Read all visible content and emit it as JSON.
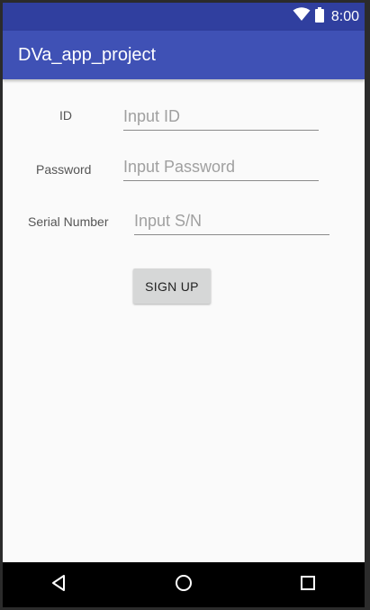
{
  "status_bar": {
    "time": "8:00",
    "icons": [
      "wifi-icon",
      "battery-icon"
    ]
  },
  "app_bar": {
    "title": "DVa_app_project"
  },
  "form": {
    "id_label": "ID",
    "id_placeholder": "Input ID",
    "password_label": "Password",
    "password_placeholder": "Input Password",
    "serial_label": "Serial Number",
    "serial_placeholder": "Input S/N",
    "signup_label": "SIGN UP"
  },
  "nav_bar": {
    "icons": [
      "back-icon",
      "home-icon",
      "recents-icon"
    ]
  },
  "colors": {
    "status_bar": "#303f9f",
    "app_bar": "#3f51b5",
    "background": "#fafafa",
    "button": "#d6d7d7"
  }
}
